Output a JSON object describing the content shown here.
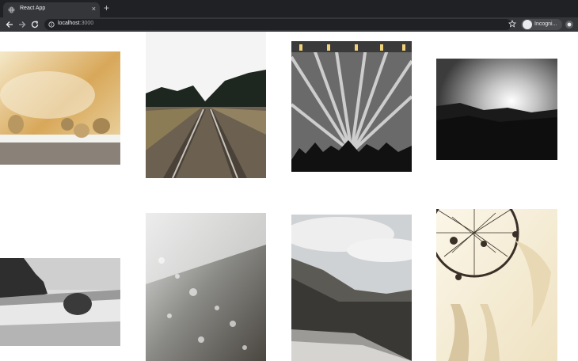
{
  "browser": {
    "tab_title": "React App",
    "tab_close": "×",
    "new_tab": "+",
    "url_host": "localhost",
    "url_port": ":3000",
    "profile_label": "Incogni..."
  },
  "icons": {
    "back": "arrow-left-icon",
    "forward": "arrow-right-icon",
    "reload": "reload-icon",
    "info": "info-icon",
    "bookmark": "star-icon",
    "profile": "incognito-icon",
    "extension": "extension-icon"
  },
  "gallery": {
    "photos": [
      {
        "subject": "dried seed pods on a rail under a golden sky"
      },
      {
        "subject": "railroad tracks through a pine forest"
      },
      {
        "subject": "concert crowd under stage light beams"
      },
      {
        "subject": "sun bursting through clouds over a dark hillside"
      },
      {
        "subject": "rocky coastline with crashing waves"
      },
      {
        "subject": "water droplets on a glass surface"
      },
      {
        "subject": "winding mountain road under clouds"
      },
      {
        "subject": "dreamcatcher with feathers"
      }
    ]
  }
}
